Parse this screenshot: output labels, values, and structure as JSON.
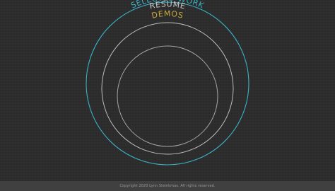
{
  "nav": {
    "selected_work": {
      "label": "SELECTED WORK",
      "color": "#39b3c8"
    },
    "resume": {
      "label": "RESUME",
      "color": "#c9c9c9"
    },
    "demos": {
      "label": "DEMOS",
      "color": "#c9aa3d"
    }
  },
  "colors": {
    "background": "#2d2d2d",
    "footer_background": "#404040",
    "footer_text": "#9a9a9a"
  },
  "footer": {
    "copyright": "Copyright 2020 Lynn Steinkmas. All rights reserved."
  }
}
